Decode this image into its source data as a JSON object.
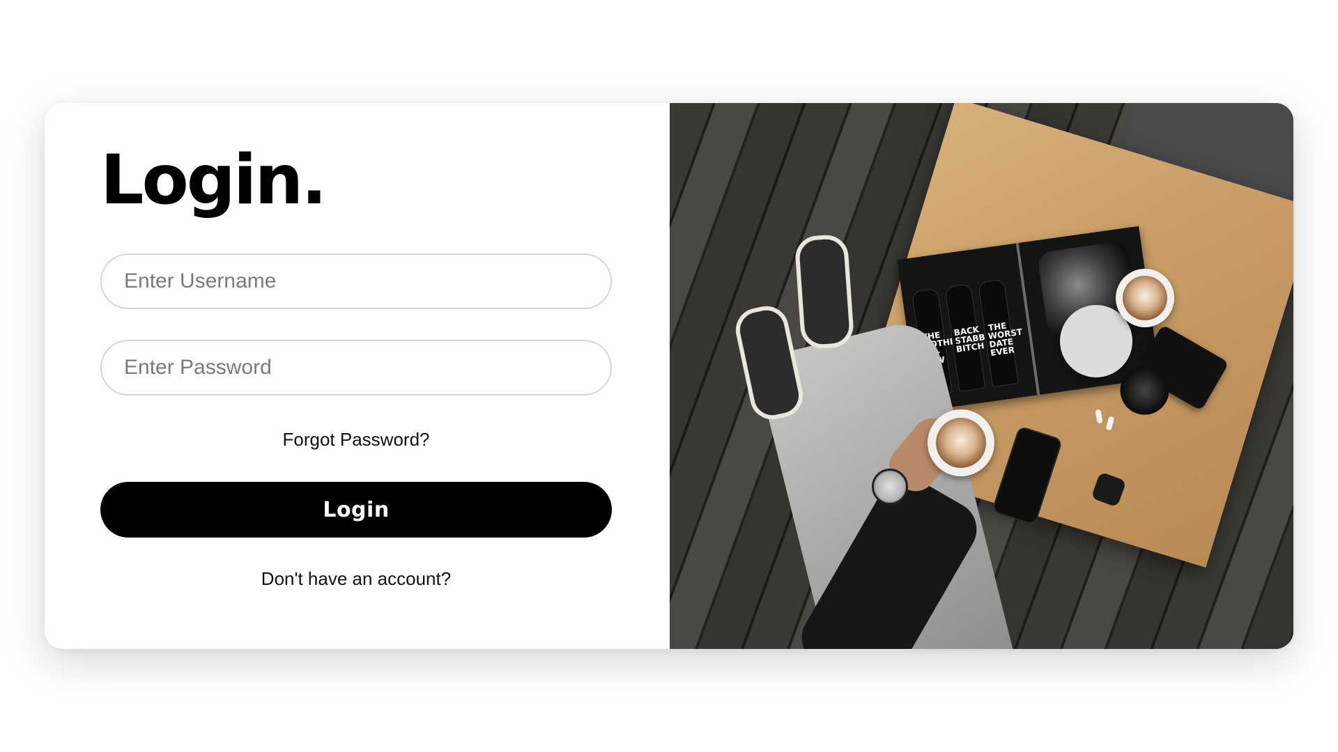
{
  "login": {
    "title": "Login.",
    "username_placeholder": "Enter Username",
    "password_placeholder": "Enter Password",
    "forgot_label": "Forgot Password?",
    "submit_label": "Login",
    "signup_label": "Don't have an account?"
  },
  "hero": {
    "magazine_texts": [
      "THE MOTHER IN-LAW",
      "BACK STABBING BITCH",
      "THE WORST DATE EVER"
    ]
  },
  "colors": {
    "primary_button": "#000000",
    "field_border": "#d6d2e0",
    "table_wood": "#c89c64",
    "floor_wood": "#3a3935"
  }
}
